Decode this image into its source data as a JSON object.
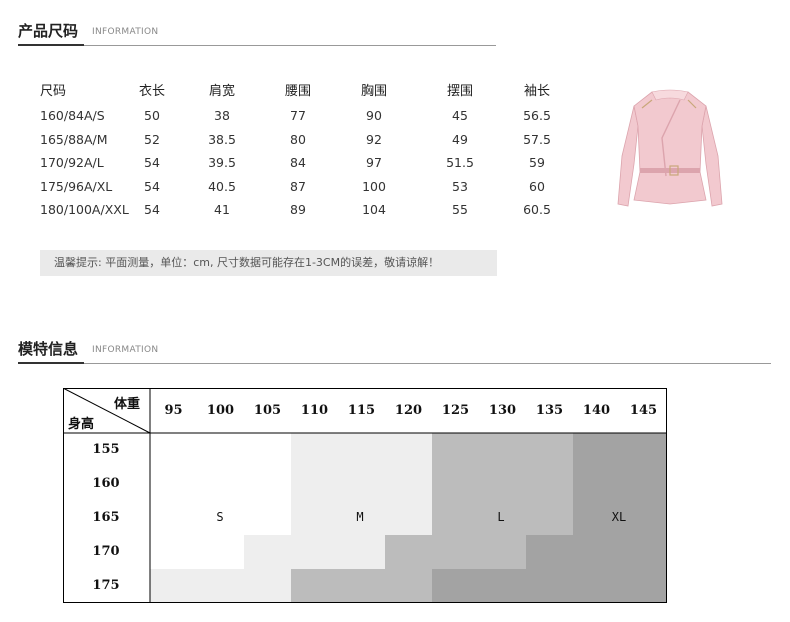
{
  "section1": {
    "title_zh": "产品尺码",
    "title_en": "INFORMATION"
  },
  "size_table": {
    "headers": [
      "尺码",
      "衣长",
      "肩宽",
      "腰围",
      "胸围",
      "摆围",
      "袖长"
    ],
    "rows": [
      [
        "160/84A/S",
        "50",
        "38",
        "77",
        "90",
        "45",
        "56.5"
      ],
      [
        "165/88A/M",
        "52",
        "38.5",
        "80",
        "92",
        "49",
        "57.5"
      ],
      [
        "170/92A/L",
        "54",
        "39.5",
        "84",
        "97",
        "51.5",
        "59"
      ],
      [
        "175/96A/XL",
        "54",
        "40.5",
        "87",
        "100",
        "53",
        "60"
      ],
      [
        "180/100A/XXL",
        "54",
        "41",
        "89",
        "104",
        "55",
        "60.5"
      ]
    ]
  },
  "tip": "温馨提示: 平面测量，单位：cm, 尺寸数据可能存在1-3CM的误差，敬请谅解！",
  "product_image": {
    "colors": {
      "jacket": "#f2c9cf",
      "shadow": "#dca4ad",
      "zip": "#c9a77a"
    }
  },
  "section2": {
    "title_zh": "模特信息",
    "title_en": "INFORMATION"
  },
  "model_chart": {
    "corner_top": "体重",
    "corner_bottom": "身高",
    "weights": [
      "95",
      "100",
      "105",
      "110",
      "115",
      "120",
      "125",
      "130",
      "135",
      "140",
      "145"
    ],
    "heights": [
      "155",
      "160",
      "165",
      "170",
      "175"
    ],
    "size_labels": [
      "S",
      "M",
      "L",
      "XL"
    ],
    "colors": {
      "S": "#ffffff",
      "M": "#eeeeee",
      "L": "#bcbcbc",
      "XL": "#a3a3a3"
    }
  }
}
